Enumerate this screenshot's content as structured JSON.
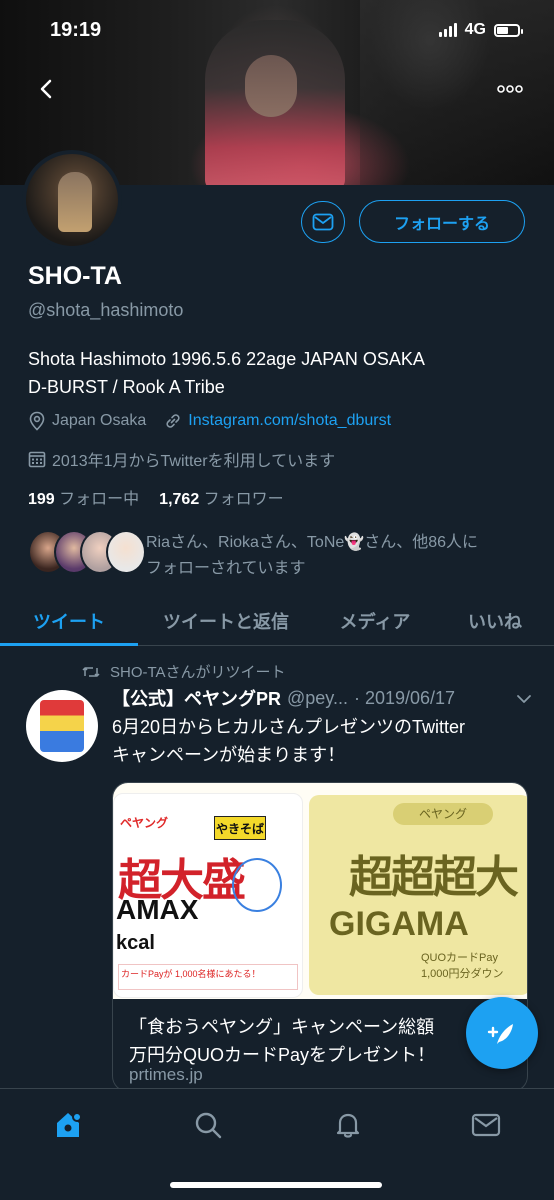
{
  "status_bar": {
    "time": "19:19",
    "network": "4G"
  },
  "profile": {
    "name": "SHO-TA",
    "handle": "@shota_hashimoto",
    "bio_line1": "Shota Hashimoto 1996.5.6 22age JAPAN OSAKA",
    "bio_line2": "D-BURST / Rook A Tribe",
    "location": "Japan Osaka",
    "link": "Instagram.com/shota_dburst",
    "joined": "2013年1月からTwitterを利用しています",
    "following_count": "199",
    "following_label": "フォロー中",
    "followers_count": "1,762",
    "followers_label": "フォロワー",
    "follow_button": "フォローする",
    "known_followers_line1": "Riaさん、Riokaさん、ToNe👻さん、他86人に",
    "known_followers_line2": "フォローされています"
  },
  "tabs": [
    {
      "label": "ツイート",
      "active": true
    },
    {
      "label": "ツイートと返信",
      "active": false
    },
    {
      "label": "メディア",
      "active": false
    },
    {
      "label": "いいね",
      "active": false
    }
  ],
  "tweet": {
    "retweet_label": "SHO-TAさんがリツイート",
    "account_name": "【公式】ペヤングPR",
    "account_handle": "@pey...",
    "date": "· 2019/06/17",
    "body_line1": "6月20日からヒカルさんプレゼンツのTwitter",
    "body_line2": "キャンペーンが始まります！",
    "card": {
      "image_left": {
        "label": "ペヤング",
        "product": "やきそば",
        "big_text": "超大盛",
        "amax": "AMAX",
        "kcal": "kcal",
        "strip_text": "カードPayが 1,000名様にあたる！"
      },
      "image_right": {
        "brand": "ペヤング",
        "big_text": "超超超大",
        "giga": "GIGAMA",
        "quo": "QUOカードPay",
        "yen": "1,000円分ダウン"
      },
      "title_line1": "「食おうペヤング」キャンペーン総額",
      "title_line2": "万円分QUOカードPayをプレゼント！",
      "domain": "prtimes.jp"
    }
  },
  "colors": {
    "accent": "#1da1f2",
    "background": "#15202b",
    "muted": "#8899a6",
    "divider": "#38444d"
  }
}
